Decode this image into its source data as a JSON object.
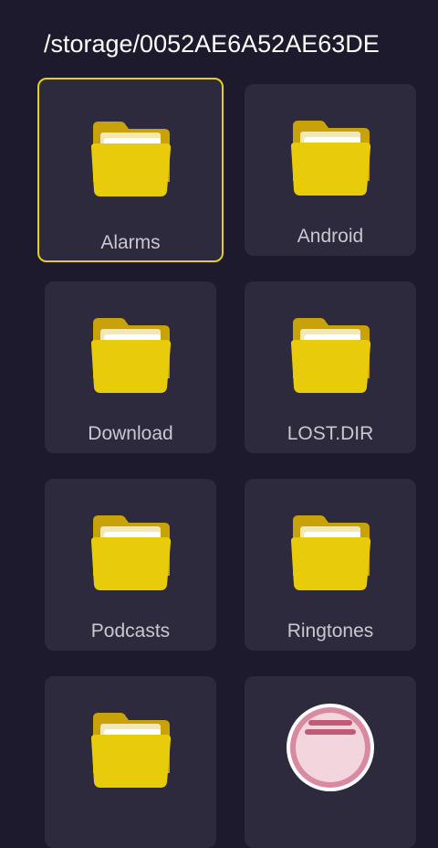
{
  "header": {
    "path": "/storage/0052AE6A52AE63DE"
  },
  "items": [
    {
      "label": "Alarms",
      "icon": "folder-icon"
    },
    {
      "label": "Android",
      "icon": "folder-icon"
    },
    {
      "label": "Download",
      "icon": "folder-icon"
    },
    {
      "label": "LOST.DIR",
      "icon": "folder-icon"
    },
    {
      "label": "Podcasts",
      "icon": "folder-icon"
    },
    {
      "label": "Ringtones",
      "icon": "folder-icon"
    },
    {
      "label": "",
      "icon": "folder-icon"
    },
    {
      "label": "",
      "icon": "music-file-icon"
    }
  ],
  "colors": {
    "background": "#1d1a2d",
    "tile": "#2c2a3c",
    "focus_border": "#e6cf14",
    "folder_front": "#e8cc0c",
    "folder_back": "#c9a20a",
    "label_text": "#c9c8d0"
  }
}
